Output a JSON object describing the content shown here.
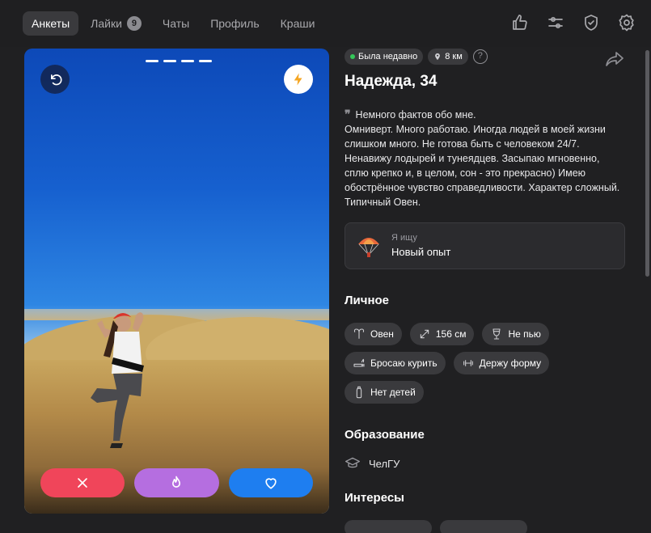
{
  "nav": {
    "tabs": [
      {
        "label": "Анкеты",
        "active": true
      },
      {
        "label": "Лайки",
        "badge": "9"
      },
      {
        "label": "Чаты"
      },
      {
        "label": "Профиль"
      },
      {
        "label": "Краши"
      }
    ],
    "icons": [
      "thumbs-up-icon",
      "sliders-icon",
      "shield-check-icon",
      "gear-icon"
    ]
  },
  "photo": {
    "indicator_count": 4,
    "actions": [
      "close-icon",
      "fire-icon",
      "heart-icon"
    ],
    "colors": {
      "dislike": "#f0455a",
      "super": "#b56ee0",
      "like": "#1e7ef0"
    }
  },
  "profile": {
    "status": "Была недавно",
    "distance": "8 км",
    "help": "?",
    "name": "Надежда, 34",
    "bio_quote": "❞",
    "bio": "Немного фактов обо мне.\nОмниверт. Много работаю. Иногда людей в моей жизни слишком много. Не готова быть с человеком 24/7. Ненавижу лодырей и тунеядцев. Засыпаю мгновенно, сплю крепко и, в целом, сон - это прекрасно) Имею обострённое чувство справедливости. Характер сложный. Типичный Овен.",
    "seeking": {
      "label": "Я ищу",
      "value": "Новый опыт",
      "icon": "parachute-icon"
    }
  },
  "personal": {
    "title": "Личное",
    "tags": [
      {
        "icon": "aries-icon",
        "label": "Овен"
      },
      {
        "icon": "height-icon",
        "label": "156 см"
      },
      {
        "icon": "glass-icon",
        "label": "Не пью"
      },
      {
        "icon": "cigarette-icon",
        "label": "Бросаю курить"
      },
      {
        "icon": "dumbbell-icon",
        "label": "Держу форму"
      },
      {
        "icon": "bottle-icon",
        "label": "Нет детей"
      }
    ]
  },
  "education": {
    "title": "Образование",
    "value": "ЧелГУ"
  },
  "interests": {
    "title": "Интересы"
  }
}
